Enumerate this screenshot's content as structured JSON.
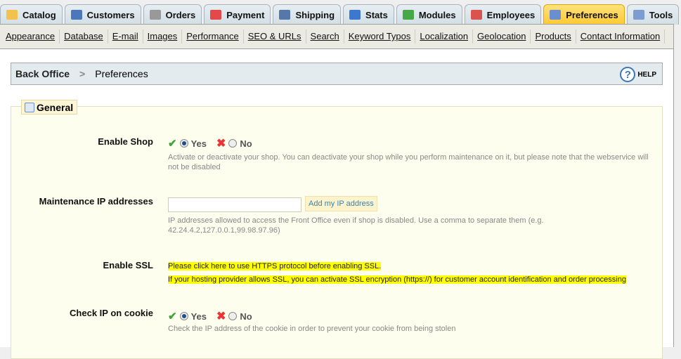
{
  "tabs": [
    {
      "label": "Catalog",
      "icon": "folder-icon",
      "color": "#f2c14e"
    },
    {
      "label": "Customers",
      "icon": "customer-icon",
      "color": "#4b78b8"
    },
    {
      "label": "Orders",
      "icon": "cart-icon",
      "color": "#999999"
    },
    {
      "label": "Payment",
      "icon": "payment-icon",
      "color": "#e44848"
    },
    {
      "label": "Shipping",
      "icon": "truck-icon",
      "color": "#5577aa"
    },
    {
      "label": "Stats",
      "icon": "bar-chart-icon",
      "color": "#3d78d0"
    },
    {
      "label": "Modules",
      "icon": "puzzle-icon",
      "color": "#46a846"
    },
    {
      "label": "Employees",
      "icon": "employee-icon",
      "color": "#d9544f"
    },
    {
      "label": "Preferences",
      "icon": "preferences-icon",
      "color": "#6a8fd0",
      "active": true
    },
    {
      "label": "Tools",
      "icon": "wrench-icon",
      "color": "#7d9ccf"
    }
  ],
  "subnav": [
    "Appearance",
    "Database",
    "E-mail",
    "Images",
    "Performance",
    "SEO & URLs",
    "Search",
    "Keyword Typos",
    "Localization",
    "Geolocation",
    "Products",
    "Contact Information"
  ],
  "breadcrumb": {
    "root": "Back Office",
    "sep": ">",
    "current": "Preferences",
    "help": "HELP"
  },
  "fieldset": {
    "legend": "General"
  },
  "fields": {
    "enable_shop": {
      "label": "Enable Shop",
      "yes": "Yes",
      "no": "No",
      "desc": "Activate or deactivate your shop. You can deactivate your shop while you perform maintenance on it, but please note that the webservice will not be disabled"
    },
    "maintenance": {
      "label": "Maintenance IP addresses",
      "value": "",
      "button": "Add my IP address",
      "desc": "IP addresses allowed to access the Front Office even if shop is disabled. Use a comma to separate them (e.g. 42.24.4.2,127.0.0.1,99.98.97.96)"
    },
    "ssl": {
      "label": "Enable SSL",
      "link": "Please click here to use HTTPS protocol before enabling SSL.",
      "note": "If your hosting provider allows SSL, you can activate SSL encryption (https://) for customer account identification and order processing"
    },
    "cookie": {
      "label": "Check IP on cookie",
      "yes": "Yes",
      "no": "No",
      "desc": "Check the IP address of the cookie in order to prevent your cookie from being stolen"
    }
  }
}
